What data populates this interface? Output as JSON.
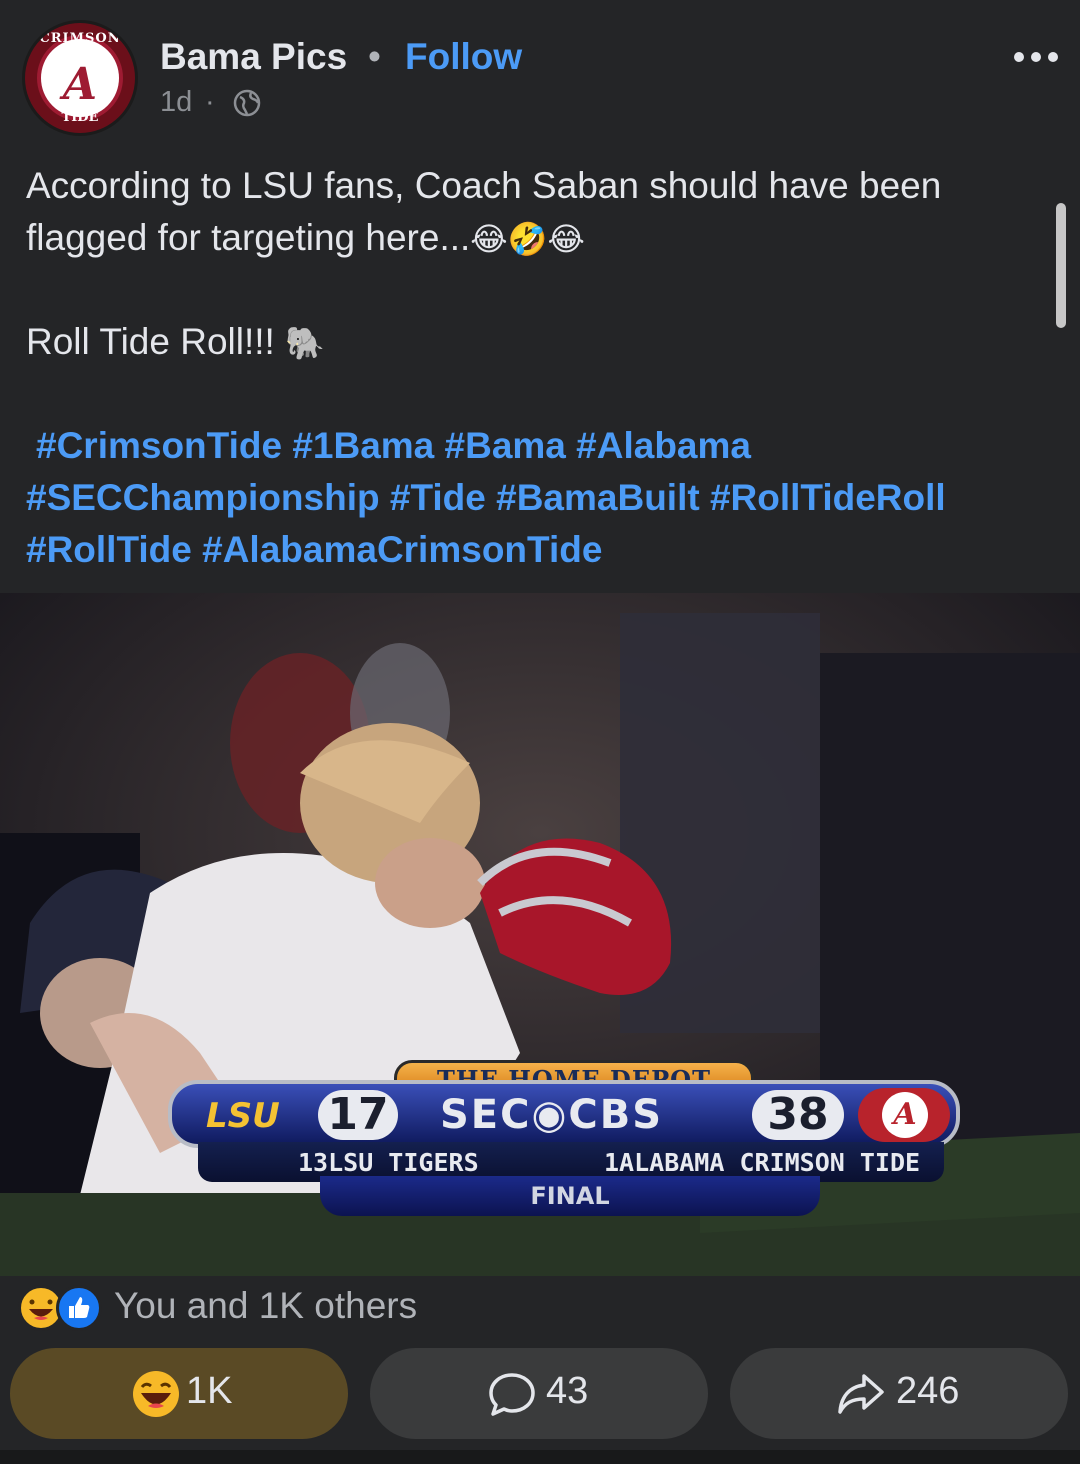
{
  "post": {
    "page_name": "Bama Pics",
    "separator": "•",
    "follow_label": "Follow",
    "time": "1d",
    "meta_separator": "·",
    "privacy_icon": "globe-icon",
    "more_icon": "more-options-icon",
    "avatar": {
      "top_text": "CRIMSON",
      "letter": "A",
      "bottom_text": "TIDE"
    },
    "caption_line1": "According to LSU fans, Coach Saban should have been",
    "caption_line2": "flagged for targeting here...",
    "caption_emojis": "😂🤣😂",
    "caption_line3": "Roll Tide Roll!!! ",
    "caption_line3_emoji": "🐘",
    "hashtags_line1": "#CrimsonTide #1Bama #Bama #Alabama",
    "hashtags_line2": "#SECChampionship #Tide #BamaBuilt #RollTideRoll",
    "hashtags_line3": "#RollTide #AlabamaCrimsonTide"
  },
  "photo": {
    "scoreboard": {
      "sponsor": "THE HOME DEPOT",
      "team_left_abbr": "LSU",
      "team_left_score": "17",
      "network": "SEC◉CBS",
      "team_right_score": "38",
      "team_right_logo": "A",
      "team_left_name": "13LSU TIGERS",
      "team_right_name": "1ALABAMA CRIMSON TIDE",
      "status": "FINAL"
    }
  },
  "reactions": {
    "summary_text": "You and 1K others",
    "icons": [
      "haha-reaction-icon",
      "like-reaction-icon"
    ]
  },
  "actions": {
    "react_count": "1K",
    "comment_count": "43",
    "share_count": "246",
    "react_icon": "haha-emoji-icon",
    "comment_icon": "comment-icon",
    "share_icon": "share-icon"
  },
  "colors": {
    "background": "#242527",
    "link_blue": "#4c9bf6",
    "active_reaction_bg": "#5a4a25",
    "button_bg": "#3a3b3c"
  }
}
